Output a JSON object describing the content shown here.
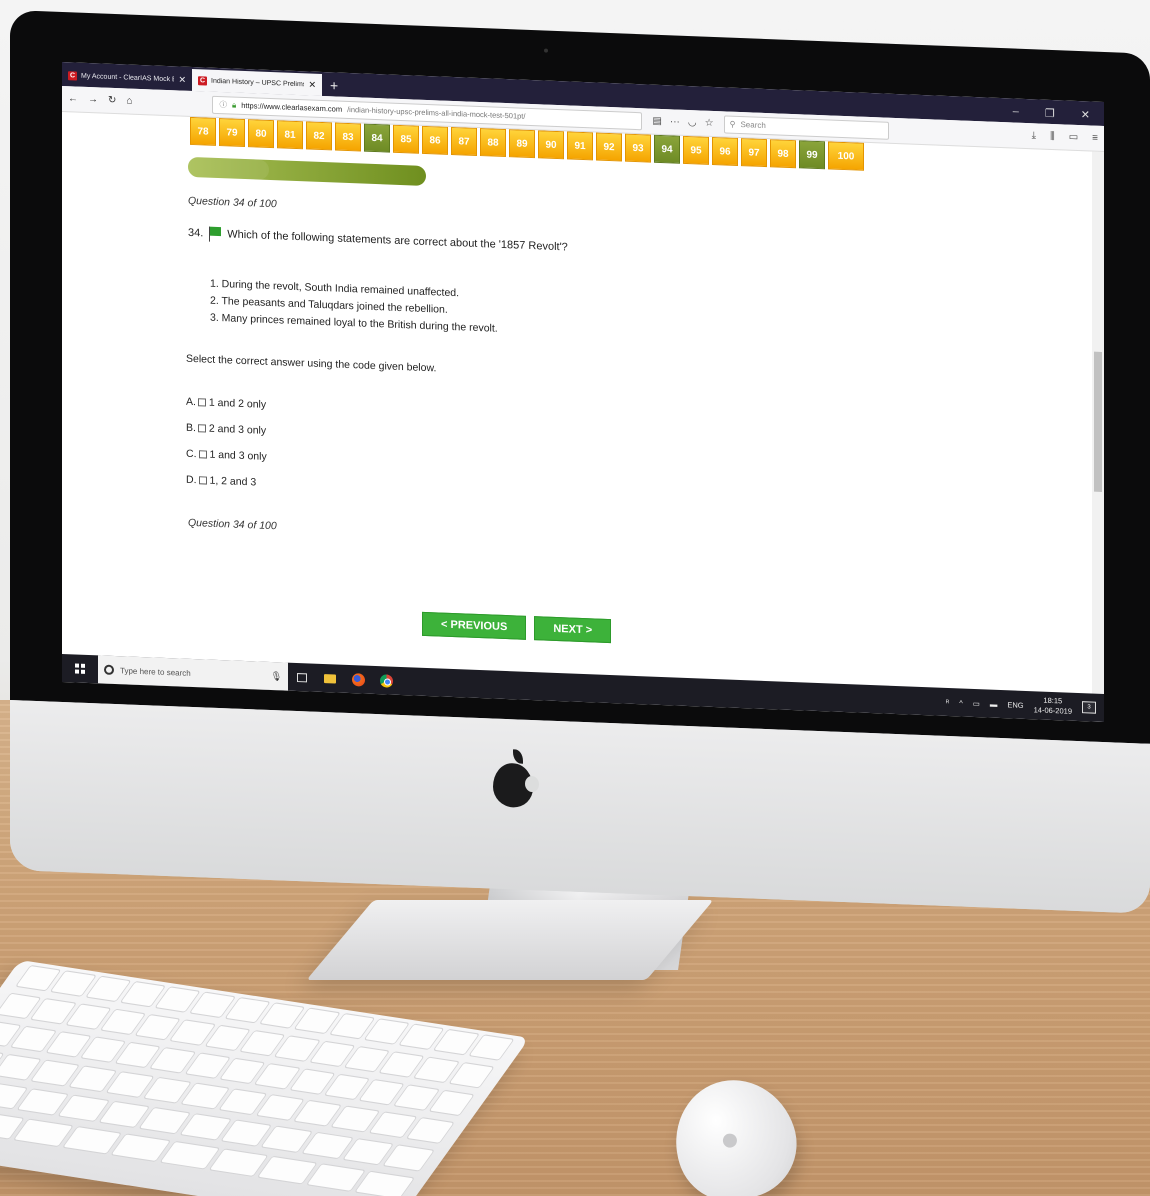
{
  "browser": {
    "tabs": [
      {
        "title": "My Account - ClearIAS Mock E",
        "favicon": "C",
        "active": false
      },
      {
        "title": "Indian History – UPSC Prelims /",
        "favicon": "C",
        "active": true
      }
    ],
    "new_tab": "+",
    "url_host": "https://www.clearlasexam.com",
    "url_path": "/indian-history-upsc-prelims-all-india-mock-test-501pt/",
    "search_placeholder": "Search"
  },
  "quiz": {
    "question_numbers": [
      {
        "n": "78",
        "done": false
      },
      {
        "n": "79",
        "done": false
      },
      {
        "n": "80",
        "done": false
      },
      {
        "n": "81",
        "done": false
      },
      {
        "n": "82",
        "done": false
      },
      {
        "n": "83",
        "done": false
      },
      {
        "n": "84",
        "done": true
      },
      {
        "n": "85",
        "done": false
      },
      {
        "n": "86",
        "done": false
      },
      {
        "n": "87",
        "done": false
      },
      {
        "n": "88",
        "done": false
      },
      {
        "n": "89",
        "done": false
      },
      {
        "n": "90",
        "done": false
      },
      {
        "n": "91",
        "done": false
      },
      {
        "n": "92",
        "done": false
      },
      {
        "n": "93",
        "done": false
      },
      {
        "n": "94",
        "done": true
      },
      {
        "n": "95",
        "done": false
      },
      {
        "n": "96",
        "done": false
      },
      {
        "n": "97",
        "done": false
      },
      {
        "n": "98",
        "done": false
      },
      {
        "n": "99",
        "done": true
      },
      {
        "n": "100",
        "done": false
      }
    ],
    "progress_fraction": 0.34,
    "counter_top": "Question 34 of 100",
    "question_number": "34.",
    "question_text": "Which of the following statements are correct about the '1857 Revolt'?",
    "statements": [
      "1. During the revolt, South India remained unaffected.",
      "2. The peasants and Taluqdars joined the rebellion.",
      "3. Many princes remained loyal to the British during the revolt."
    ],
    "instruction": "Select the correct answer using the code given below.",
    "options": [
      {
        "letter": "A.",
        "text": "1 and 2 only"
      },
      {
        "letter": "B.",
        "text": "2 and 3 only"
      },
      {
        "letter": "C.",
        "text": "1 and 3 only"
      },
      {
        "letter": "D.",
        "text": "1, 2 and 3"
      }
    ],
    "counter_bottom": "Question 34 of 100",
    "prev_label": "< PREVIOUS",
    "next_label": "NEXT >"
  },
  "taskbar": {
    "search_placeholder": "Type here to search",
    "language": "ENG",
    "time": "18:15",
    "date": "14-06-2019",
    "notification_count": "3"
  },
  "colors": {
    "qnum_pending": "#f5a400",
    "qnum_done": "#6e8b25",
    "button_green": "#3db23a",
    "tabbar": "#23203a"
  }
}
